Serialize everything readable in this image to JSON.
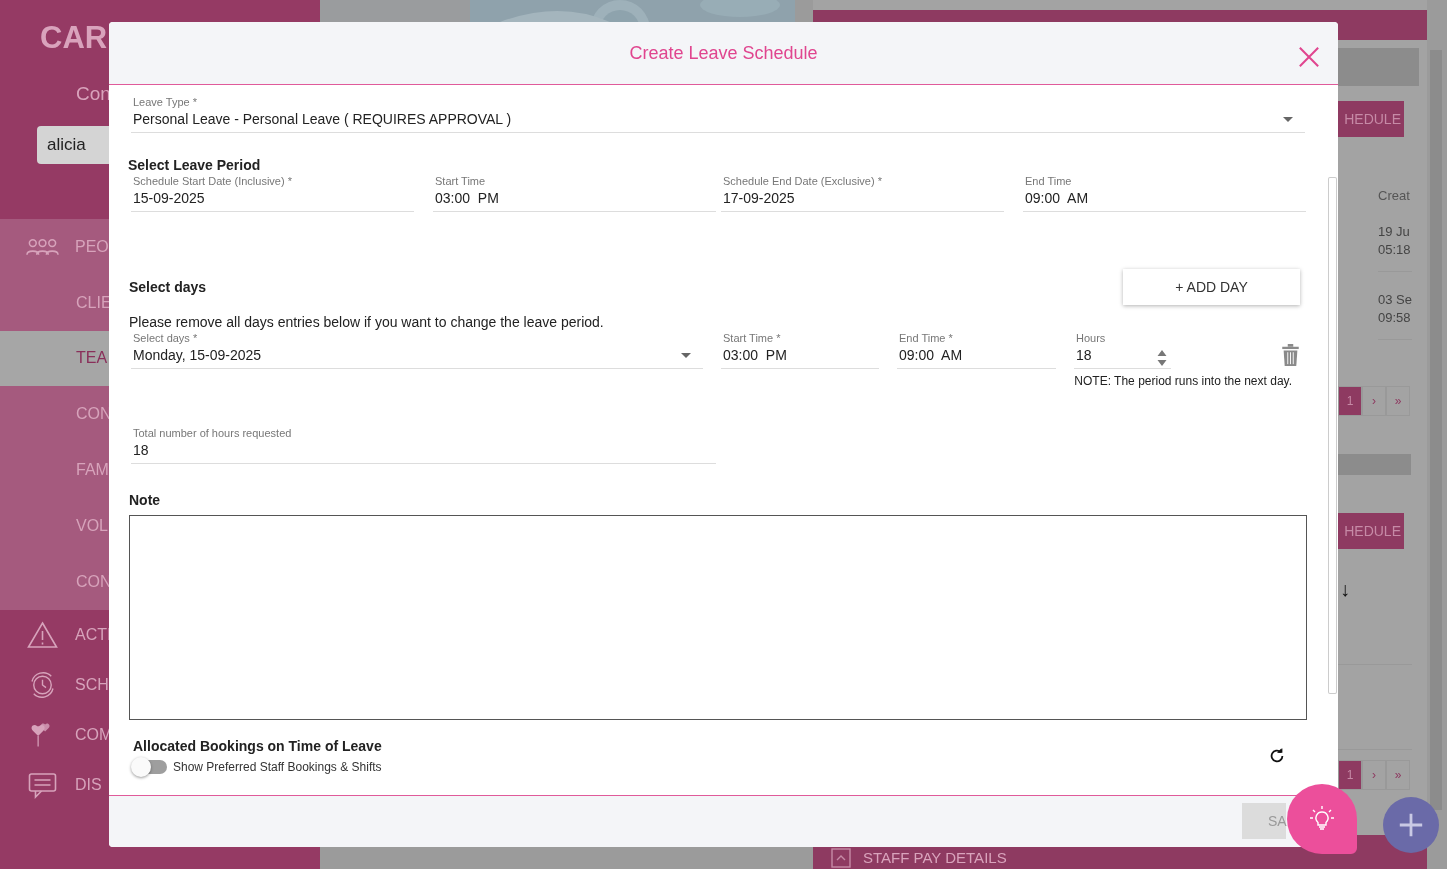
{
  "sidebar": {
    "logo": "CAR",
    "subtitle": "Con",
    "search": {
      "value": "alicia"
    },
    "menu": [
      {
        "label": "PEO",
        "kind": "people",
        "expanded": true,
        "children": [
          {
            "label": "CLIE",
            "selected": false
          },
          {
            "label": "TEA",
            "selected": true
          },
          {
            "label": "CON",
            "selected": false
          },
          {
            "label": "FAM",
            "selected": false
          },
          {
            "label": "VOL",
            "selected": false
          },
          {
            "label": "CON",
            "selected": false
          }
        ]
      },
      {
        "label": "ACTI",
        "kind": "warning",
        "expanded": false
      },
      {
        "label": "SCH",
        "kind": "schedule",
        "expanded": false
      },
      {
        "label": "COM",
        "kind": "hearts",
        "expanded": false
      },
      {
        "label": "DIS",
        "kind": "chat",
        "expanded": false
      }
    ]
  },
  "right_panel": {
    "buttons": [
      "HEDULE",
      "HEDULE"
    ],
    "table": {
      "header": "Creat",
      "rows": [
        [
          "19 Ju",
          "05:18"
        ],
        [
          "03 Se",
          "09:58"
        ]
      ]
    },
    "pagers": [
      [
        {
          "label": "1",
          "selected": true
        },
        {
          "label": "›",
          "selected": false
        },
        {
          "label": "»",
          "selected": false
        }
      ],
      [
        {
          "label": "1",
          "selected": true
        },
        {
          "label": "›",
          "selected": false
        },
        {
          "label": "»",
          "selected": false
        }
      ]
    ],
    "sort_arrow": "↓",
    "footer_title": "STAFF PAY DETAILS"
  },
  "modal": {
    "title": "Create Leave Schedule",
    "leave_type": {
      "label": "Leave Type *",
      "value": "Personal Leave - Personal Leave ( REQUIRES APPROVAL )"
    },
    "leave_period": {
      "heading": "Select Leave Period",
      "fields": [
        {
          "label": "Schedule Start Date (Inclusive) *",
          "value": "15-09-2025"
        },
        {
          "label": "Start Time",
          "value": "03:00  PM"
        },
        {
          "label": "Schedule End Date (Exclusive) *",
          "value": "17-09-2025"
        },
        {
          "label": "End Time",
          "value": "09:00  AM"
        }
      ]
    },
    "select_days": {
      "heading": "Select days",
      "add_button": "+ ADD DAY",
      "hint": "Please remove all days entries below if you want to change the leave period.",
      "day": {
        "label": "Select days *",
        "value": "Monday, 15-09-2025"
      },
      "start": {
        "label": "Start Time *",
        "value": "03:00  PM"
      },
      "end": {
        "label": "End Time *",
        "value": "09:00  AM"
      },
      "hours": {
        "label": "Hours",
        "value": "18"
      },
      "note": "NOTE: The period runs into the next day."
    },
    "total": {
      "label": "Total number of hours requested",
      "value": "18"
    },
    "note": {
      "label": "Note"
    },
    "bookings": {
      "heading": "Allocated Bookings on Time of Leave",
      "toggle": {
        "label": "Show Preferred Staff Bookings & Shifts",
        "on": false
      }
    },
    "save_button": "SA"
  }
}
